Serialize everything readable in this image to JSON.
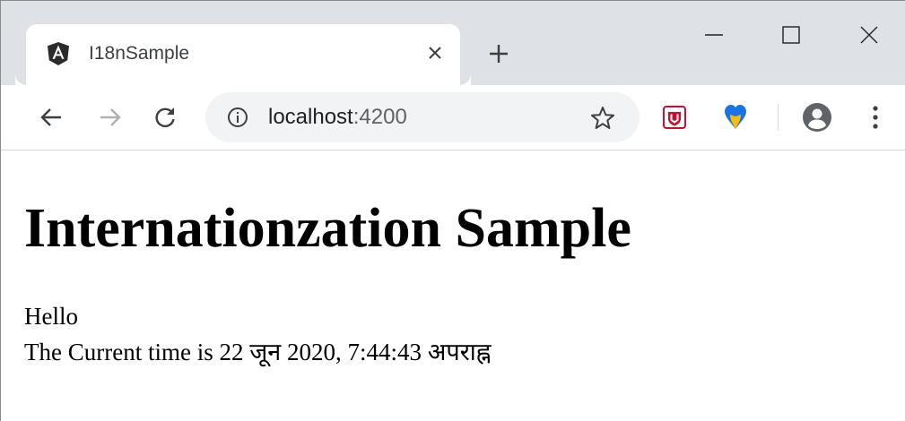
{
  "browser": {
    "tab": {
      "title": "I18nSample",
      "favicon": "angular-logo-icon"
    },
    "new_tab_icon": "plus-icon",
    "window_controls": [
      "minimize-icon",
      "maximize-icon",
      "close-icon"
    ],
    "toolbar": {
      "nav_icons": [
        "back-arrow-icon",
        "forward-arrow-icon",
        "reload-icon"
      ],
      "address": {
        "host": "localhost",
        "port": ":4200",
        "info_icon": "info-icon"
      },
      "bookmark_icon": "star-icon",
      "extensions": [
        "mcafee-shield-icon",
        "heart-drop-extension-icon"
      ],
      "profile_icon": "account-circle-icon",
      "menu_icon": "kebab-menu-icon"
    },
    "colors": {
      "tabstrip": "#dee1e6",
      "omnibox": "#f1f3f4",
      "accent_red": "#c8102e",
      "accent_blue": "#1a73e8"
    }
  },
  "page": {
    "heading": "Internationzation Sample",
    "greeting": "Hello",
    "time_prefix": "The Current time is ",
    "time_value": "22 जून 2020, 7:44:43 अपराह्न"
  }
}
